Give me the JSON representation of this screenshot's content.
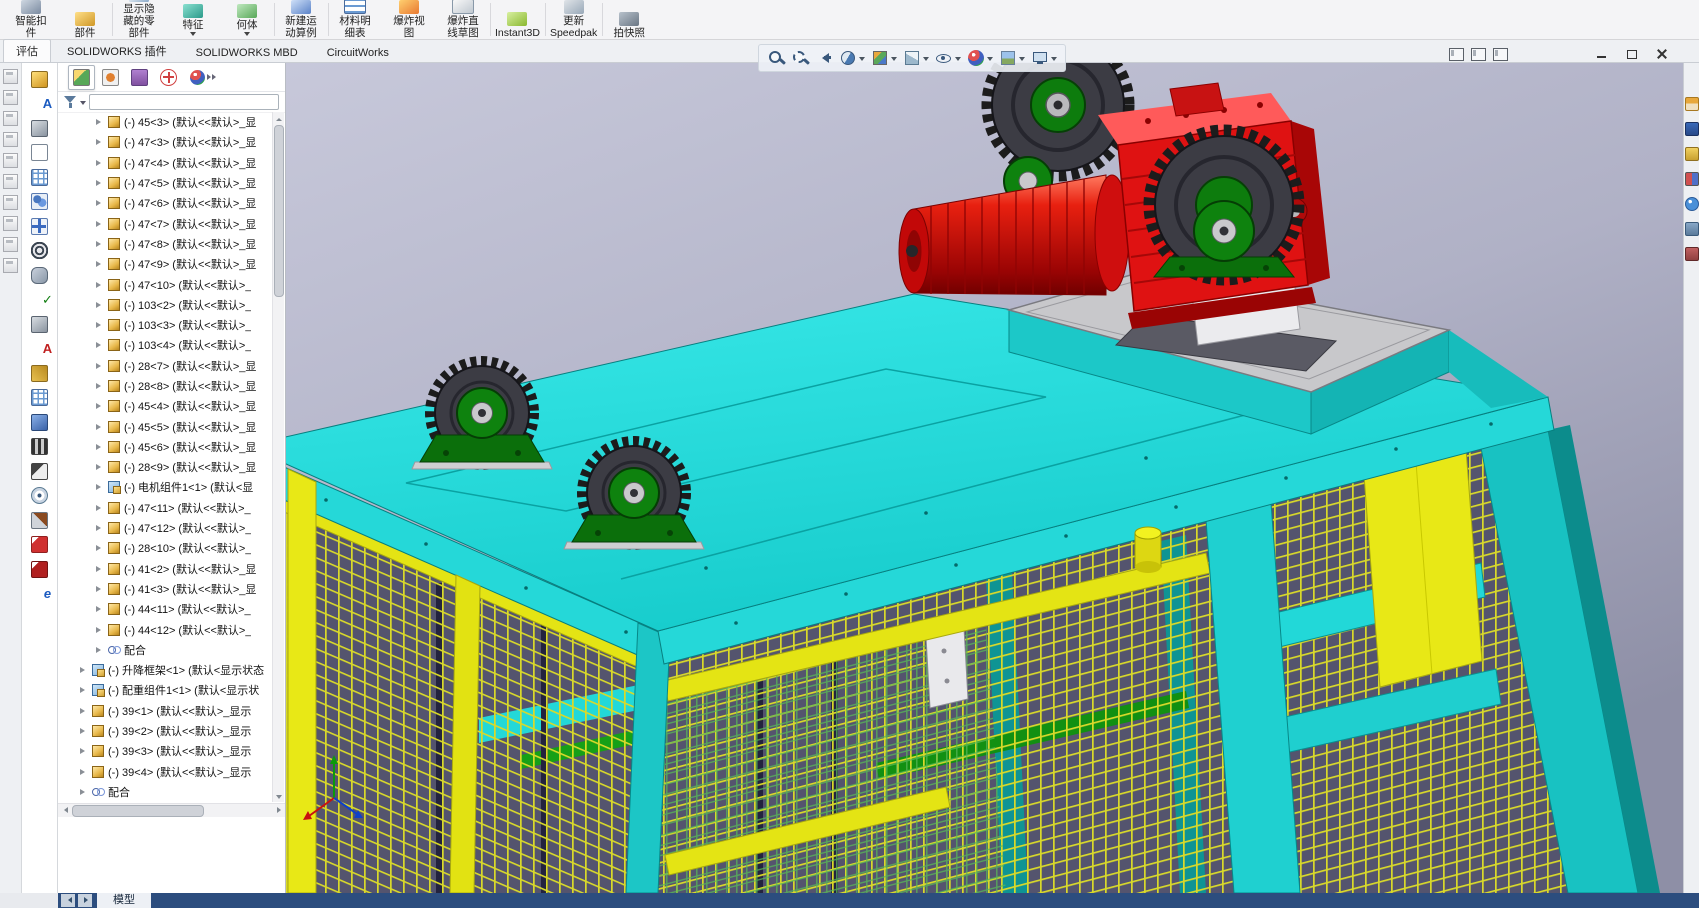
{
  "app": {
    "name": "SolidWorks assembly workspace"
  },
  "ribbon": {
    "buttons": [
      {
        "label": [
          "智能扣",
          "件",
          ""
        ],
        "cls": "i-r1"
      },
      {
        "label": [
          "部件",
          "",
          ""
        ],
        "cls": "i-r2 sep"
      },
      {
        "label": [
          "显示隐",
          "藏的零",
          "部件"
        ],
        "cls": "i-r3"
      },
      {
        "label": [
          "特征",
          "",
          ""
        ],
        "cls": "i-r4 caret"
      },
      {
        "label": [
          "何体",
          "",
          ""
        ],
        "cls": "i-r5 caret sep"
      },
      {
        "label": [
          "新建运",
          "动算例",
          ""
        ],
        "cls": "i-r6 sep"
      },
      {
        "label": [
          "材料明",
          "细表",
          ""
        ],
        "cls": "i-r7"
      },
      {
        "label": [
          "爆炸视",
          "图",
          ""
        ],
        "cls": "i-r8"
      },
      {
        "label": [
          "爆炸直",
          "线草图",
          ""
        ],
        "cls": "i-r9 sep"
      },
      {
        "label": [
          "Instant3D",
          "",
          ""
        ],
        "cls": "i-r10 sep"
      },
      {
        "label": [
          "更新",
          "Speedpak",
          ""
        ],
        "cls": "i-r11 sep"
      },
      {
        "label": [
          "拍快照",
          "",
          ""
        ],
        "cls": "i-r12"
      }
    ]
  },
  "tabs": {
    "items": [
      {
        "label": "评估",
        "cls": "active"
      },
      {
        "label": "SOLIDWORKS 插件",
        "cls": ""
      },
      {
        "label": "SOLIDWORKS MBD",
        "cls": ""
      },
      {
        "label": "CircuitWorks",
        "cls": ""
      }
    ]
  },
  "headsup": {
    "icons": [
      {
        "name": "zoom-fit-icon",
        "cls": "i-mag"
      },
      {
        "name": "zoom-area-icon",
        "cls": "i-mag i-mag2"
      },
      {
        "name": "previous-view-icon",
        "cls": "i-prev"
      },
      {
        "name": "section-view-icon",
        "cls": "i-section c"
      },
      {
        "name": "view-orientation-icon",
        "cls": "i-orient c"
      },
      {
        "name": "display-style-icon",
        "cls": "i-display c"
      },
      {
        "name": "hide-show-items-icon",
        "cls": "i-hide c"
      },
      {
        "name": "edit-appearance-icon",
        "cls": "i-appearance c"
      },
      {
        "name": "apply-scene-icon",
        "cls": "i-scene c"
      },
      {
        "name": "view-settings-icon",
        "cls": "i-monitor c"
      }
    ]
  },
  "leftstrip": {
    "icons": [
      {
        "name": "dock-tool-icon-1"
      },
      {
        "name": "dock-tool-icon-2"
      },
      {
        "name": "dock-tool-icon-3"
      },
      {
        "name": "dock-tool-icon-4"
      },
      {
        "name": "dock-tool-icon-5"
      },
      {
        "name": "dock-tool-icon-6"
      },
      {
        "name": "dock-tool-icon-7"
      },
      {
        "name": "dock-tool-icon-8"
      },
      {
        "name": "dock-tool-icon-9"
      },
      {
        "name": "dock-tool-icon-10"
      }
    ]
  },
  "asmbar": {
    "icons": [
      {
        "name": "insert-component-icon",
        "cls": "b-gold",
        "glyph": "",
        "style": ""
      },
      {
        "name": "annotation-icon",
        "cls": "",
        "glyph": "A",
        "style": "color:#1a5ac0"
      },
      {
        "name": "smart-fastener-icon",
        "cls": "b-steel",
        "glyph": "",
        "style": ""
      },
      {
        "name": "reference-part-icon",
        "cls": "b-out",
        "glyph": "",
        "style": ""
      },
      {
        "name": "bom-icon",
        "cls": "b-table",
        "glyph": "",
        "style": ""
      },
      {
        "name": "component-group-icon",
        "cls": "b-people",
        "glyph": "",
        "style": ""
      },
      {
        "name": "move-component-icon",
        "cls": "b-move",
        "glyph": "",
        "style": ""
      },
      {
        "name": "rotate-component-icon",
        "cls": "b-wheel",
        "glyph": "",
        "style": ""
      },
      {
        "name": "mate-icon",
        "cls": "b-clip",
        "glyph": "",
        "style": ""
      },
      {
        "name": "interference-check-icon",
        "cls": "",
        "glyph": "✓",
        "style": "color:#0f7d0f"
      },
      {
        "name": "measure-icon",
        "cls": "b-steel",
        "glyph": "",
        "style": ""
      },
      {
        "name": "note-icon",
        "cls": "",
        "glyph": "A",
        "style": "color:#c02020"
      },
      {
        "name": "leader-arrow-icon",
        "cls": "b-gold2",
        "glyph": "",
        "style": ""
      },
      {
        "name": "design-table-icon",
        "cls": "b-table",
        "glyph": "",
        "style": ""
      },
      {
        "name": "view-3d-icon",
        "cls": "b-blue",
        "glyph": "",
        "style": ""
      },
      {
        "name": "motion-study-icon",
        "cls": "b-film",
        "glyph": "",
        "style": ""
      },
      {
        "name": "animation-icon",
        "cls": "b-clap",
        "glyph": "",
        "style": ""
      },
      {
        "name": "visibility-icon",
        "cls": "b-eye",
        "glyph": "",
        "style": ""
      },
      {
        "name": "section-tool-icon",
        "cls": "b-knife",
        "glyph": "",
        "style": ""
      },
      {
        "name": "save-pdf-icon",
        "cls": "b-red",
        "glyph": "",
        "style": ""
      },
      {
        "name": "publish-icon",
        "cls": "b-red2",
        "glyph": "",
        "style": ""
      },
      {
        "name": "edrawings-icon",
        "cls": "",
        "glyph": "e",
        "style": "color:#1a5ac0;font-style:italic"
      }
    ]
  },
  "treepanel": {
    "header": [
      {
        "name": "featuremanager-tab",
        "cls": "th-fm active"
      },
      {
        "name": "propertymanager-tab",
        "cls": "th-pm"
      },
      {
        "name": "configurationmanager-tab",
        "cls": "th-cm"
      },
      {
        "name": "dimxpertmanager-tab",
        "cls": "th-dx"
      },
      {
        "name": "displaymanager-tab",
        "cls": "th-dm"
      }
    ],
    "items": [
      {
        "label": "(-) 45<3> (默认<<默认>_显",
        "cls": "ind2 t-part"
      },
      {
        "label": "(-) 47<3> (默认<<默认>_显",
        "cls": "ind2 t-part"
      },
      {
        "label": "(-) 47<4> (默认<<默认>_显",
        "cls": "ind2 t-part"
      },
      {
        "label": "(-) 47<5> (默认<<默认>_显",
        "cls": "ind2 t-part"
      },
      {
        "label": "(-) 47<6> (默认<<默认>_显",
        "cls": "ind2 t-part"
      },
      {
        "label": "(-) 47<7> (默认<<默认>_显",
        "cls": "ind2 t-part"
      },
      {
        "label": "(-) 47<8> (默认<<默认>_显",
        "cls": "ind2 t-part"
      },
      {
        "label": "(-) 47<9> (默认<<默认>_显",
        "cls": "ind2 t-part"
      },
      {
        "label": "(-) 47<10> (默认<<默认>_",
        "cls": "ind2 t-part"
      },
      {
        "label": "(-) 103<2> (默认<<默认>_",
        "cls": "ind2 t-part"
      },
      {
        "label": "(-) 103<3> (默认<<默认>_",
        "cls": "ind2 t-part"
      },
      {
        "label": "(-) 103<4> (默认<<默认>_",
        "cls": "ind2 t-part"
      },
      {
        "label": "(-) 28<7> (默认<<默认>_显",
        "cls": "ind2 t-part"
      },
      {
        "label": "(-) 28<8> (默认<<默认>_显",
        "cls": "ind2 t-part"
      },
      {
        "label": "(-) 45<4> (默认<<默认>_显",
        "cls": "ind2 t-part"
      },
      {
        "label": "(-) 45<5> (默认<<默认>_显",
        "cls": "ind2 t-part"
      },
      {
        "label": "(-) 45<6> (默认<<默认>_显",
        "cls": "ind2 t-part"
      },
      {
        "label": "(-) 28<9> (默认<<默认>_显",
        "cls": "ind2 t-part"
      },
      {
        "label": "(-) 电机组件1<1> (默认<显",
        "cls": "ind2 t-asm"
      },
      {
        "label": "(-) 47<11> (默认<<默认>_",
        "cls": "ind2 t-part"
      },
      {
        "label": "(-) 47<12> (默认<<默认>_",
        "cls": "ind2 t-part"
      },
      {
        "label": "(-) 28<10> (默认<<默认>_",
        "cls": "ind2 t-part"
      },
      {
        "label": "(-) 41<2> (默认<<默认>_显",
        "cls": "ind2 t-part"
      },
      {
        "label": "(-) 41<3> (默认<<默认>_显",
        "cls": "ind2 t-part"
      },
      {
        "label": "(-) 44<11> (默认<<默认>_",
        "cls": "ind2 t-part"
      },
      {
        "label": "(-) 44<12> (默认<<默认>_",
        "cls": "ind2 t-part"
      },
      {
        "label": "配合",
        "cls": "ind2 t-mates"
      },
      {
        "label": "(-) 升降框架<1> (默认<显示状态",
        "cls": "ind1 t-asm"
      },
      {
        "label": "(-) 配重组件1<1> (默认<显示状",
        "cls": "ind1 t-asm"
      },
      {
        "label": "(-) 39<1> (默认<<默认>_显示",
        "cls": "ind1 t-part"
      },
      {
        "label": "(-) 39<2> (默认<<默认>_显示",
        "cls": "ind1 t-part"
      },
      {
        "label": "(-) 39<3> (默认<<默认>_显示",
        "cls": "ind1 t-part"
      },
      {
        "label": "(-) 39<4> (默认<<默认>_显示",
        "cls": "ind1 t-part"
      },
      {
        "label": "配合",
        "cls": "ind1 t-mates"
      }
    ]
  },
  "rightstrip": {
    "icons": [
      {
        "name": "task-home-icon",
        "cls": "r-home"
      },
      {
        "name": "design-library-icon",
        "cls": "r-lib"
      },
      {
        "name": "file-explorer-icon",
        "cls": "r-files"
      },
      {
        "name": "view-palette-icon",
        "cls": "r-pal"
      },
      {
        "name": "appearances-icon",
        "cls": "r-app"
      },
      {
        "name": "scenes-icon",
        "cls": "r-scene"
      },
      {
        "name": "custom-properties-icon",
        "cls": "r-props"
      }
    ]
  },
  "bottom": {
    "tabs": [
      {
        "label": "模型",
        "cls": ""
      }
    ]
  },
  "scene": {
    "colors": {
      "frame_cyan": "#1fd2d2",
      "frame_yellow": "#e4e414",
      "motor_red": "#df1212",
      "bearing_green": "#0e820e",
      "sprocket_dark": "#3c3c44",
      "mesh_background": "#54546e",
      "plate_gray": "#c8c8cb",
      "backdrop_top": "#c7c8da",
      "backdrop_bottom": "#8e8fa6"
    },
    "components": [
      "roof",
      "cage-left-face",
      "cage-front-face",
      "sprocket-top",
      "sprocket-right",
      "sprocket-left",
      "sprocket-mid",
      "gear-motor",
      "gear-reducer",
      "motor-platform",
      "pillow-bearings",
      "origin-triad"
    ]
  }
}
